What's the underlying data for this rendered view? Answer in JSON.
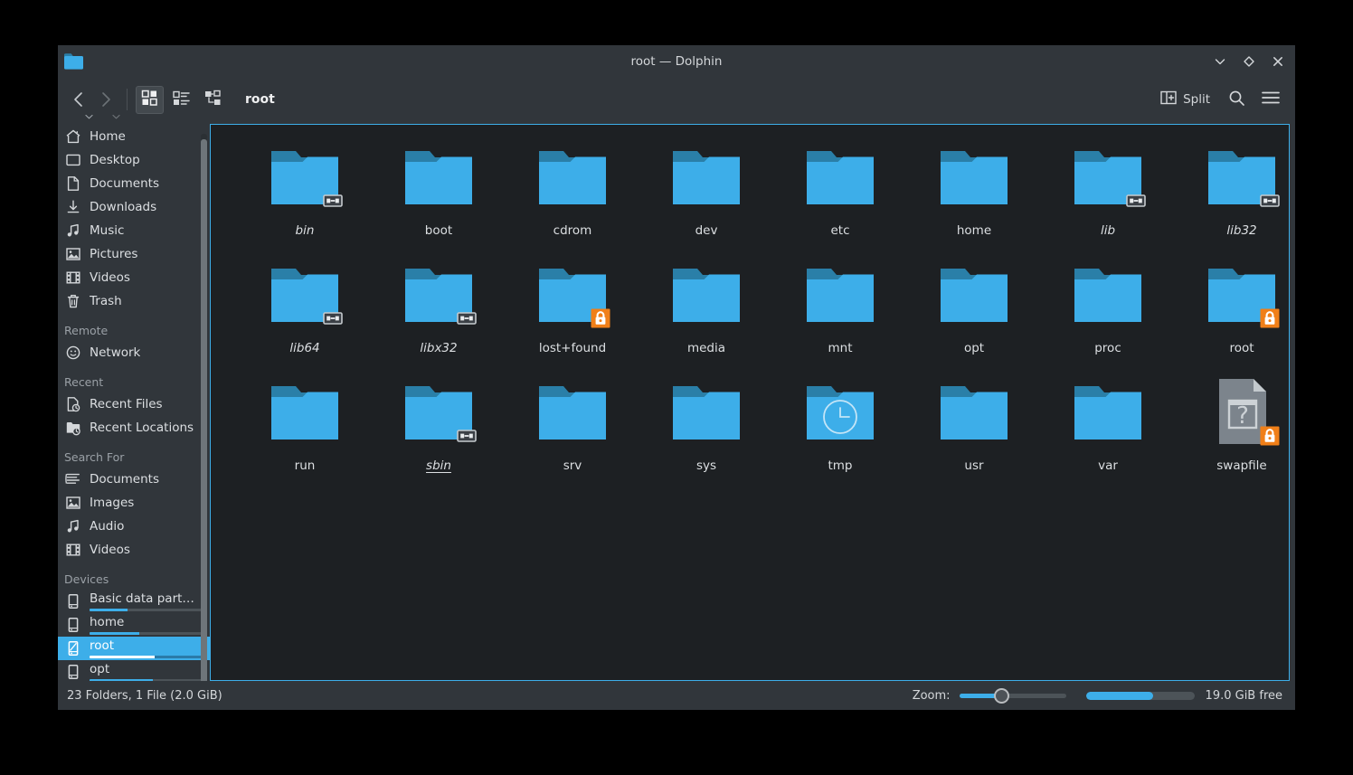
{
  "window": {
    "title": "root — Dolphin",
    "app_icon": "folder-icon",
    "controls": [
      {
        "name": "minimize-button",
        "icon": "chevron-down-icon"
      },
      {
        "name": "maximize-button",
        "icon": "diamond-icon"
      },
      {
        "name": "close-button",
        "icon": "close-icon"
      }
    ]
  },
  "toolbar": {
    "back": {
      "icon": "back-arrow-icon",
      "enabled": true
    },
    "forward": {
      "icon": "forward-arrow-icon",
      "enabled": false
    },
    "view_modes": [
      {
        "name": "icons-view",
        "icon": "grid-view-icon",
        "active": true
      },
      {
        "name": "compact-view",
        "icon": "list-view-icon",
        "active": false
      },
      {
        "name": "details-view",
        "icon": "tree-view-icon",
        "active": false
      }
    ],
    "breadcrumb": "root",
    "split_label": "Split",
    "split_icon": "split-view-icon",
    "search_icon": "search-icon",
    "menu_icon": "hamburger-menu-icon"
  },
  "sidebar": {
    "places": [
      {
        "label": "Home",
        "icon": "home-icon"
      },
      {
        "label": "Desktop",
        "icon": "desktop-icon"
      },
      {
        "label": "Documents",
        "icon": "document-icon"
      },
      {
        "label": "Downloads",
        "icon": "download-icon"
      },
      {
        "label": "Music",
        "icon": "music-note-icon"
      },
      {
        "label": "Pictures",
        "icon": "image-icon"
      },
      {
        "label": "Videos",
        "icon": "film-icon"
      },
      {
        "label": "Trash",
        "icon": "trash-icon"
      }
    ],
    "remote_header": "Remote",
    "remote": [
      {
        "label": "Network",
        "icon": "network-icon"
      }
    ],
    "recent_header": "Recent",
    "recent": [
      {
        "label": "Recent Files",
        "icon": "recent-file-icon"
      },
      {
        "label": "Recent Locations",
        "icon": "recent-folder-icon"
      }
    ],
    "search_header": "Search For",
    "search_for": [
      {
        "label": "Documents",
        "icon": "text-lines-icon"
      },
      {
        "label": "Images",
        "icon": "image-icon"
      },
      {
        "label": "Audio",
        "icon": "music-note-icon"
      },
      {
        "label": "Videos",
        "icon": "film-icon"
      }
    ],
    "devices_header": "Devices",
    "devices": [
      {
        "label": "Basic data part…",
        "icon": "drive-icon",
        "capacity_percent": 33,
        "selected": false
      },
      {
        "label": "home",
        "icon": "drive-icon",
        "capacity_percent": 43,
        "selected": false
      },
      {
        "label": "root",
        "icon": "drive-selected-icon",
        "capacity_percent": 57,
        "selected": true
      },
      {
        "label": "opt",
        "icon": "drive-icon",
        "capacity_percent": 55,
        "selected": false
      }
    ]
  },
  "files": [
    {
      "name": "bin",
      "type": "folder",
      "emblem": "symlink",
      "italic": true,
      "underline": false
    },
    {
      "name": "boot",
      "type": "folder",
      "emblem": null,
      "italic": false,
      "underline": false
    },
    {
      "name": "cdrom",
      "type": "folder",
      "emblem": null,
      "italic": false,
      "underline": false
    },
    {
      "name": "dev",
      "type": "folder",
      "emblem": null,
      "italic": false,
      "underline": false
    },
    {
      "name": "etc",
      "type": "folder",
      "emblem": null,
      "italic": false,
      "underline": false
    },
    {
      "name": "home",
      "type": "folder",
      "emblem": null,
      "italic": false,
      "underline": false
    },
    {
      "name": "lib",
      "type": "folder",
      "emblem": "symlink",
      "italic": true,
      "underline": false
    },
    {
      "name": "lib32",
      "type": "folder",
      "emblem": "symlink",
      "italic": true,
      "underline": false
    },
    {
      "name": "lib64",
      "type": "folder",
      "emblem": "symlink",
      "italic": true,
      "underline": false
    },
    {
      "name": "libx32",
      "type": "folder",
      "emblem": "symlink",
      "italic": true,
      "underline": false
    },
    {
      "name": "lost+found",
      "type": "folder",
      "emblem": "lock",
      "italic": false,
      "underline": false
    },
    {
      "name": "media",
      "type": "folder",
      "emblem": null,
      "italic": false,
      "underline": false
    },
    {
      "name": "mnt",
      "type": "folder",
      "emblem": null,
      "italic": false,
      "underline": false
    },
    {
      "name": "opt",
      "type": "folder",
      "emblem": null,
      "italic": false,
      "underline": false
    },
    {
      "name": "proc",
      "type": "folder",
      "emblem": null,
      "italic": false,
      "underline": false
    },
    {
      "name": "root",
      "type": "folder",
      "emblem": "lock",
      "italic": false,
      "underline": false
    },
    {
      "name": "run",
      "type": "folder",
      "emblem": null,
      "italic": false,
      "underline": false
    },
    {
      "name": "sbin",
      "type": "folder",
      "emblem": "symlink",
      "italic": true,
      "underline": true
    },
    {
      "name": "srv",
      "type": "folder",
      "emblem": null,
      "italic": false,
      "underline": false
    },
    {
      "name": "sys",
      "type": "folder",
      "emblem": null,
      "italic": false,
      "underline": false
    },
    {
      "name": "tmp",
      "type": "folder",
      "emblem": "clock",
      "italic": false,
      "underline": false
    },
    {
      "name": "usr",
      "type": "folder",
      "emblem": null,
      "italic": false,
      "underline": false
    },
    {
      "name": "var",
      "type": "folder",
      "emblem": null,
      "italic": false,
      "underline": false
    },
    {
      "name": "swapfile",
      "type": "unknown-file",
      "emblem": "lock",
      "italic": false,
      "underline": false
    }
  ],
  "statusbar": {
    "summary": "23 Folders, 1 File (2.0 GiB)",
    "zoom_label": "Zoom:",
    "zoom_percent": 40,
    "space_used_percent": 62,
    "free_space": "19.0 GiB free"
  },
  "colors": {
    "accent": "#3daee9",
    "window_bg": "#31363b",
    "view_bg": "#1d2023",
    "folder": "#3daee9",
    "folder_tab": "#2a7fa8",
    "lock_badge": "#f07f18",
    "text": "#dcdfe2",
    "muted_text": "#9aa0a6"
  }
}
